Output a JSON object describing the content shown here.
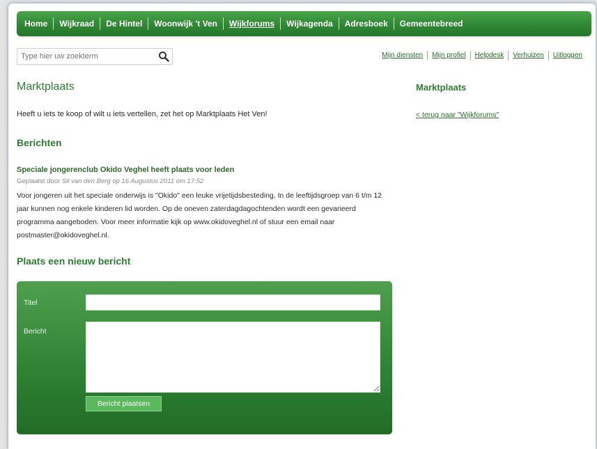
{
  "nav": {
    "items": [
      {
        "label": "Home"
      },
      {
        "label": "Wijkraad"
      },
      {
        "label": "De Hintel"
      },
      {
        "label": "Woonwijk 't Ven"
      },
      {
        "label": "Wijkforums",
        "active": true
      },
      {
        "label": "Wijkagenda"
      },
      {
        "label": "Adresboek"
      },
      {
        "label": "Gemeentebreed"
      }
    ]
  },
  "search": {
    "placeholder": "Type hier uw zoekterm"
  },
  "util_links": [
    "Mijn diensten",
    "Mijn profiel",
    "Helpdesk",
    "Verhuizen",
    "Uitloggen"
  ],
  "main": {
    "title": "Marktplaats",
    "intro": "Heeft u iets te koop of wilt u iets vertellen, zet het op Marktplaats Het Ven!",
    "posts_heading": "Berichten",
    "post": {
      "title": "Speciale jongerenclub Okido Veghel heeft plaats voor leden",
      "meta_prefix": "Geplaatst door ",
      "author": "Sil van den Berg",
      "meta_on": " op ",
      "date": "16 Augustus 2011 om 17:52",
      "body": "Voor jongeren uit het speciale onderwijs is \"Okido\" een leuke vrijetijdsbesteding. In de leeftijdsgroep van 6 t/m 12 jaar kunnen nog enkele kinderen lid worden. Op de oneven zaterdagdagochtenden wordt een gevarieerd programma aangeboden. Voor meer informatie kijk op www.okidoveghel.nl of stuur een email naar postmaster@okidoveghel.nl."
    },
    "new_post_heading": "Plaats een nieuw bericht"
  },
  "form": {
    "title_label": "Titel",
    "title_value": "",
    "message_label": "Bericht",
    "message_value": "",
    "submit_label": "Bericht plaatsen"
  },
  "sidebar": {
    "title": "Marktplaats",
    "back_link": "< terug naar \"Wijkforums\""
  },
  "colors": {
    "nav_green": "#2f8833",
    "heading_green": "#2e7d32",
    "link_green": "#2a6a2a",
    "button_green": "#5cb85c"
  }
}
